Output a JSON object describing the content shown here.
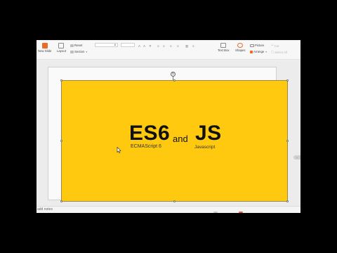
{
  "ribbon": {
    "new_slide": "New Slide",
    "layout": "Layout",
    "reset": "Reset",
    "section": "Section",
    "font_size": "8",
    "text_box": "Text Box",
    "shapes": "Shapes",
    "picture": "Picture",
    "arrange": "Arrange",
    "cut": "Cut",
    "select_all": "Select All"
  },
  "slide": {
    "title_left": "ES6",
    "connector": "and",
    "title_right": "JS",
    "subtitle_left": "ECMAScript 6",
    "subtitle_right": "Javascript",
    "background_color": "#fec90f"
  },
  "notes": {
    "placeholder": "add notes"
  },
  "colors": {
    "accent": "#e86b2a",
    "canvas": "#ececec",
    "outer_background": "#000000"
  }
}
